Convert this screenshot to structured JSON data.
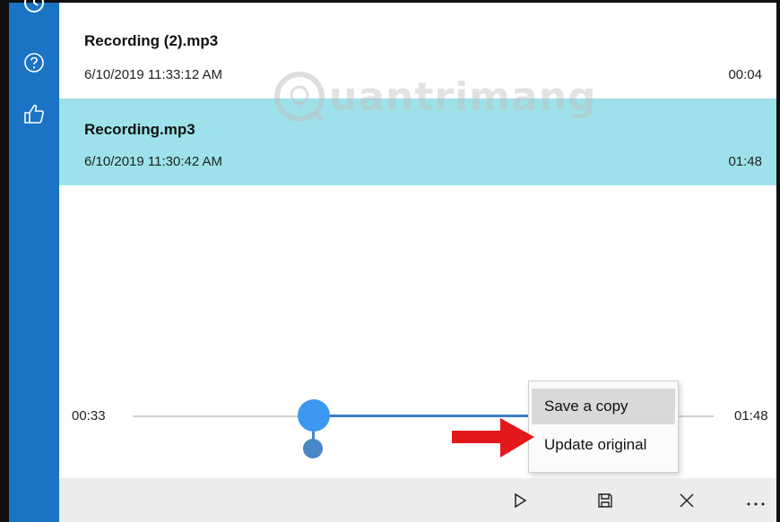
{
  "recordings": [
    {
      "name": "Recording (2).mp3",
      "date": "6/10/2019 11:33:12 AM",
      "duration": "00:04"
    },
    {
      "name": "Recording.mp3",
      "date": "6/10/2019 11:30:42 AM",
      "duration": "01:48"
    }
  ],
  "watermark": "uantrimang",
  "playback": {
    "current_time": "00:33",
    "total_time": "01:48",
    "progress_fraction": 0.31
  },
  "context_menu": {
    "items": [
      "Save a copy",
      "Update original"
    ]
  },
  "icons": {
    "sidebar": [
      "history-icon",
      "help-icon",
      "feedback-icon"
    ],
    "commands": [
      "play-icon",
      "save-icon",
      "cancel-icon",
      "more-icon"
    ]
  },
  "colors": {
    "sidebar": "#1a73c4",
    "selected_row": "#9de2ea",
    "slider_thumb": "#3c97f0",
    "arrow": "#e3181b"
  }
}
